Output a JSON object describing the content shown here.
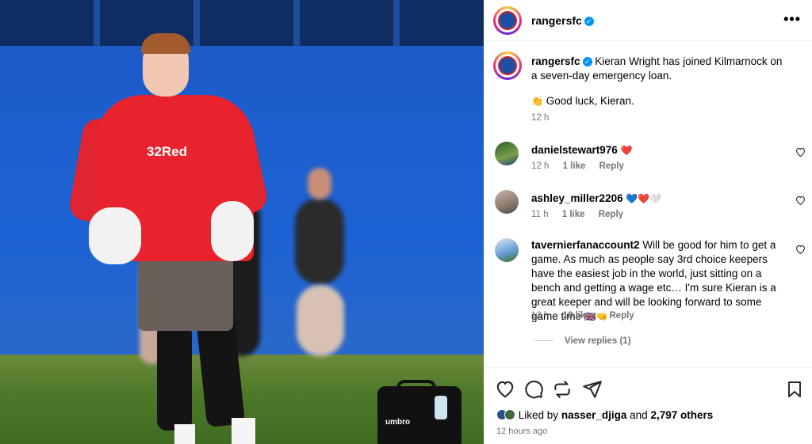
{
  "post": {
    "photo_sponsor": "32Red",
    "photo_bag_logo": "umbro",
    "author": "rangersfc",
    "more_label": "•••",
    "caption_user": "rangersfc",
    "caption_line1": "Kieran Wright has joined Kilmarnock on a seven-day emergency loan.",
    "caption_line2": "Good luck, Kieran.",
    "caption_emoji": "👏",
    "caption_time": "12 h"
  },
  "comments": [
    {
      "user": "danielstewart976",
      "text": "",
      "emoji": "❤️",
      "time": "12 h",
      "likes": "1 like",
      "reply": "Reply"
    },
    {
      "user": "ashley_miller2206",
      "text": "",
      "emoji": "💙❤️🤍",
      "time": "11 h",
      "likes": "1 like",
      "reply": "Reply"
    },
    {
      "user": "tavernierfanaccount2",
      "text": "Will be good for him to get a game. As much as people say 3rd choice keepers have the easiest job in the world, just sitting on a bench and getting a wage etc… I'm sure Kieran is a great keeper and will be looking forward to some game time",
      "emoji": "🇬🇧🤜",
      "time": "12 h",
      "likes": "18 likes",
      "reply": "Reply"
    }
  ],
  "view_replies": "View replies (1)",
  "likes_bar": {
    "prefix": "Liked by",
    "user": "nasser_djiga",
    "middle": "and",
    "others": "2,797 others"
  },
  "post_time": "12 hours ago",
  "colors": {
    "link_blue": "#0095f6",
    "heart_red": "#ed4956",
    "muted_text": "#737373"
  }
}
